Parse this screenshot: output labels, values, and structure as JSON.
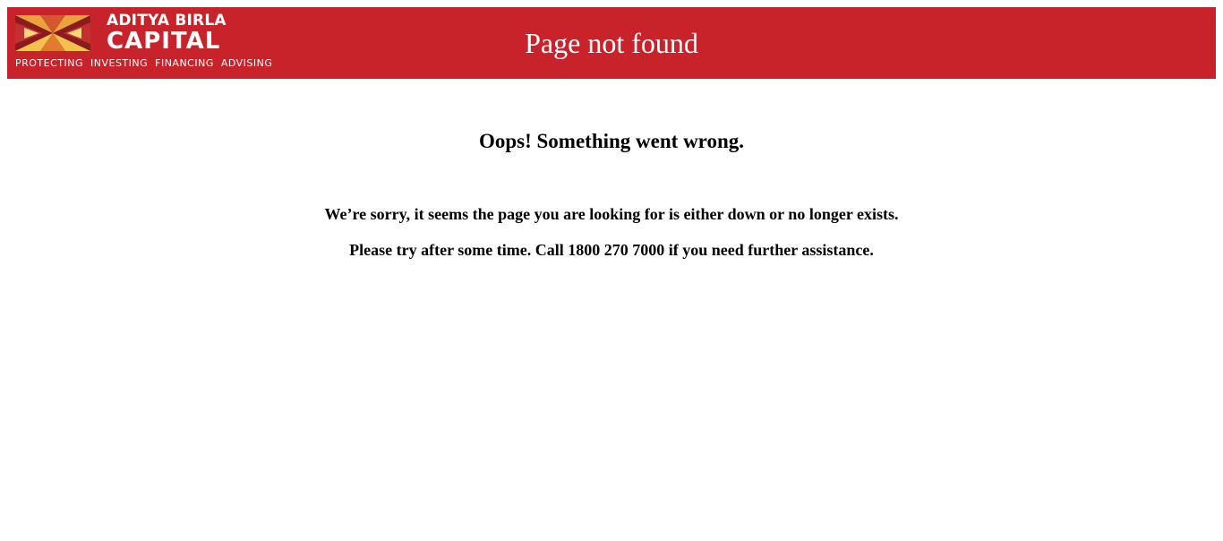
{
  "header": {
    "brand_line1": "ADITYA BIRLA",
    "brand_line2": "CAPITAL",
    "tagline": "PROTECTING  INVESTING  FINANCING  ADVISING",
    "title": "Page not found",
    "background_color": "#c8232a",
    "logo_icon": "aditya-birla-sun-logo"
  },
  "main": {
    "heading": "Oops! Something went wrong.",
    "message_line1": "We’re sorry, it seems the page you are looking for is either down or no longer exists.",
    "message_line2": "Please try after some time. Call 1800 270 7000 if you need further assistance."
  }
}
